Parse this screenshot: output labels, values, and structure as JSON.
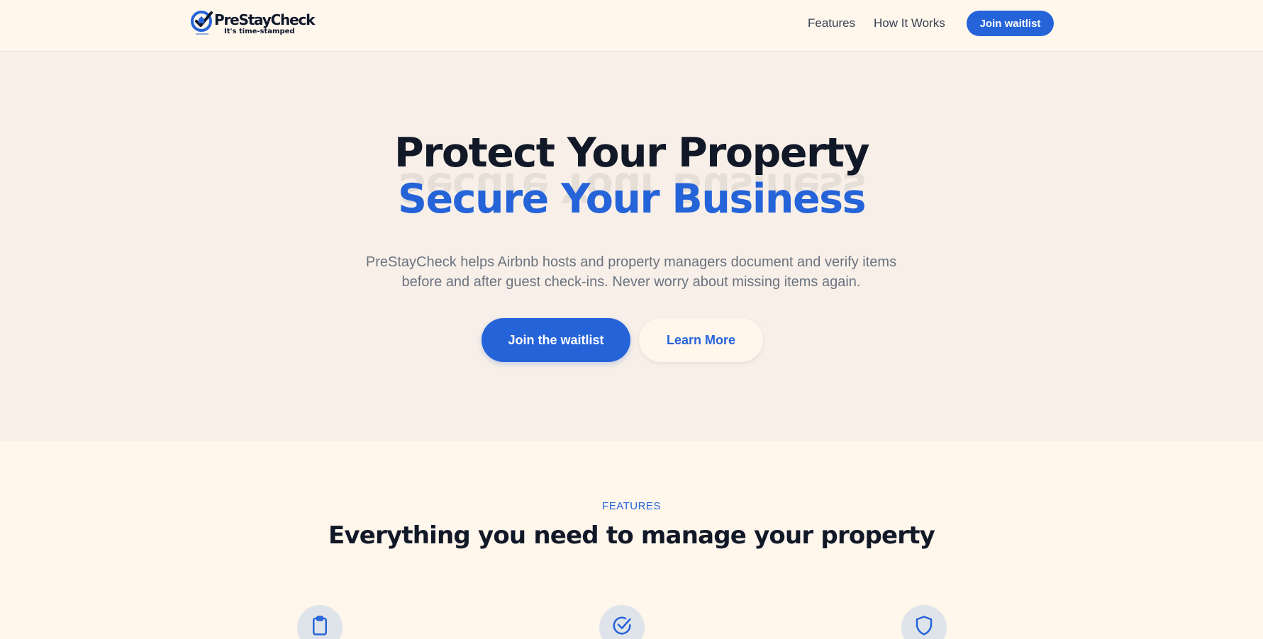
{
  "nav": {
    "logo_name": "PreStayCheck",
    "logo_tagline": "It's time-stamped",
    "links": [
      "Features",
      "How It Works"
    ],
    "cta": "Join waitlist"
  },
  "hero": {
    "title_line1": "Protect Your Property",
    "title_line2": "Secure Your Business",
    "description": "PreStayCheck helps Airbnb hosts and property managers document and verify items before and after guest check-ins. Never worry about missing items again.",
    "primary_button": "Join the waitlist",
    "secondary_button": "Learn More"
  },
  "features": {
    "eyebrow": "FEATURES",
    "title": "Everything you need to manage your property",
    "icons": [
      "clipboard-icon",
      "check-circle-icon",
      "shield-icon"
    ]
  },
  "colors": {
    "accent": "#2563d9",
    "background": "#fff6ec",
    "hero_background": "#f8f0e8",
    "heading": "#111827"
  }
}
